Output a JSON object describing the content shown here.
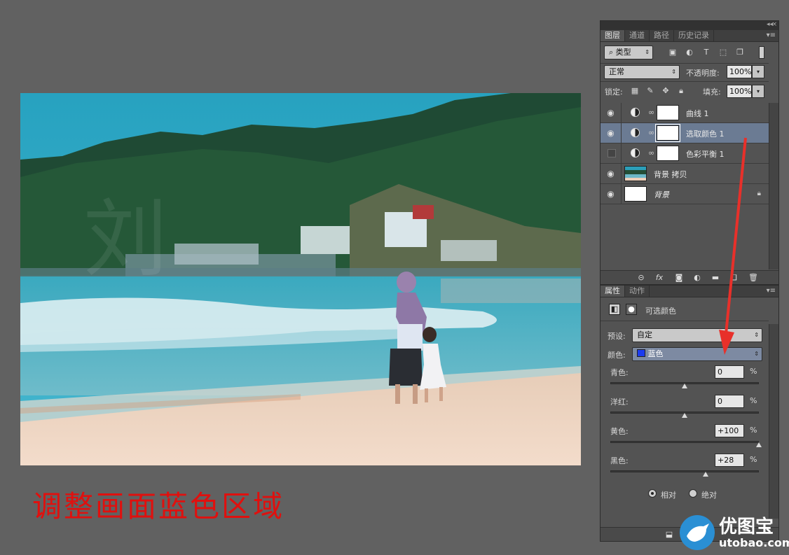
{
  "caption": "调整画面蓝色区域",
  "layers_panel": {
    "tabs": [
      "图层",
      "通道",
      "路径",
      "历史记录"
    ],
    "filter_kind": "类型",
    "blend_mode": "正常",
    "opacity_label": "不透明度:",
    "opacity_value": "100%",
    "lock_label": "锁定:",
    "fill_label": "填充:",
    "fill_value": "100%",
    "layers": [
      {
        "name": "曲线 1",
        "visible": true,
        "selected": false
      },
      {
        "name": "选取颜色 1",
        "visible": true,
        "selected": true
      },
      {
        "name": "色彩平衡 1",
        "visible": false,
        "selected": false
      },
      {
        "name": "背景 拷贝",
        "visible": true,
        "selected": false
      },
      {
        "name": "背景",
        "visible": true,
        "selected": false
      }
    ]
  },
  "properties_panel": {
    "tabs": [
      "属性",
      "动作"
    ],
    "title": "可选颜色",
    "preset_label": "预设:",
    "preset_value": "自定",
    "color_label": "颜色:",
    "color_value": "蓝色",
    "color_swatch": "#1c3cf0",
    "sliders": [
      {
        "label": "青色:",
        "value": "0",
        "unit": "%",
        "level": 0
      },
      {
        "label": "洋红:",
        "value": "0",
        "unit": "%",
        "level": 0
      },
      {
        "label": "黄色:",
        "value": "+100",
        "unit": "%",
        "level": 100
      },
      {
        "label": "黑色:",
        "value": "+28",
        "unit": "%",
        "level": 28
      }
    ],
    "mode_relative": "相对",
    "mode_absolute": "绝对",
    "mode_selected": "相对"
  },
  "watermark": {
    "name": "优图宝",
    "url": "utobao.com"
  },
  "colors": {
    "caption_red": "#e0100e",
    "selected_layer": "#6b7b93",
    "arrow_red": "#e8302a"
  }
}
